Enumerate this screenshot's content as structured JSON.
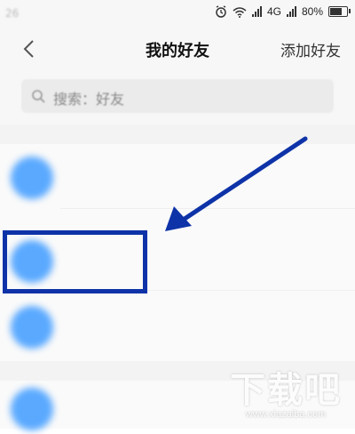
{
  "status_bar": {
    "time": "26",
    "network": "4G",
    "battery": "80%",
    "battery_level": 0.8
  },
  "nav": {
    "title": "我的好友",
    "add_friend": "添加好友"
  },
  "search": {
    "placeholder": "搜索：好友"
  },
  "friends": {
    "group_label": "",
    "items": [
      {
        "name": "",
        "avatar_color": "#5aa9ff"
      },
      {
        "name": "",
        "avatar_color": "#5aa9ff"
      },
      {
        "name": "",
        "avatar_color": "#5aa9ff"
      },
      {
        "name": "",
        "avatar_color": "#5aa9ff"
      }
    ]
  },
  "annotation": {
    "color": "#0e33a8"
  },
  "watermark": {
    "logo": "下载吧",
    "url": "www.xiazaiba.com"
  }
}
